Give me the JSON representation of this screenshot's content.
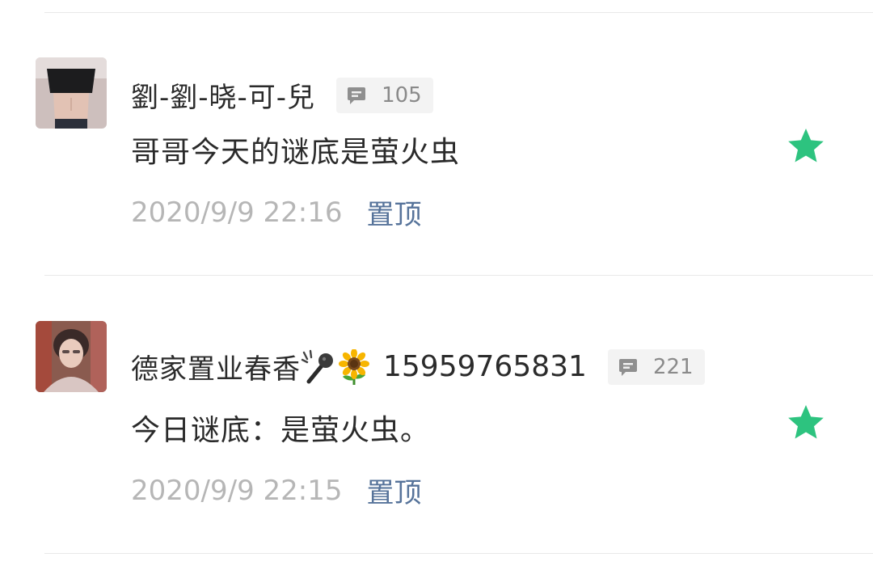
{
  "colors": {
    "star": "#2dc37f",
    "pin_link": "#56739a",
    "timestamp": "#b6b6b6",
    "reply_badge_bg": "#f3f3f3"
  },
  "comments": [
    {
      "username": "劉-劉-晓-可-兒",
      "username_emojis": [],
      "phone": "",
      "reply_count": "105",
      "content": "哥哥今天的谜底是萤火虫",
      "timestamp": "2020/9/9 22:16",
      "pin_label": "置顶",
      "starred": true,
      "icons": {
        "reply": "comment-bubble-icon",
        "star": "star-icon"
      }
    },
    {
      "username": "德家置业春香",
      "username_emojis": [
        "microphone-emoji",
        "sunflower-emoji"
      ],
      "phone": "15959765831",
      "reply_count": "221",
      "content": "今日谜底：是萤火虫。",
      "timestamp": "2020/9/9 22:15",
      "pin_label": "置顶",
      "starred": true,
      "icons": {
        "reply": "comment-bubble-icon",
        "star": "star-icon"
      }
    }
  ]
}
